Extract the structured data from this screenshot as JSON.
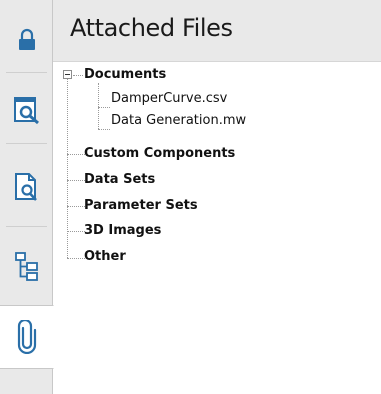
{
  "panel": {
    "title": "Attached Files"
  },
  "toolbar": {
    "items": [
      {
        "icon": "lock-icon"
      },
      {
        "icon": "document-browser-icon"
      },
      {
        "icon": "file-search-icon"
      },
      {
        "icon": "hierarchy-icon"
      },
      {
        "icon": "paperclip-icon",
        "active": true
      }
    ],
    "icon_color": "#2a6fa8"
  },
  "tree": {
    "documents_label": "Documents",
    "documents_children": [
      "DamperCurve.csv",
      "Data Generation.mw"
    ],
    "custom_components_label": "Custom Components",
    "data_sets_label": "Data Sets",
    "parameter_sets_label": "Parameter Sets",
    "images_3d_label": "3D Images",
    "other_label": "Other"
  }
}
